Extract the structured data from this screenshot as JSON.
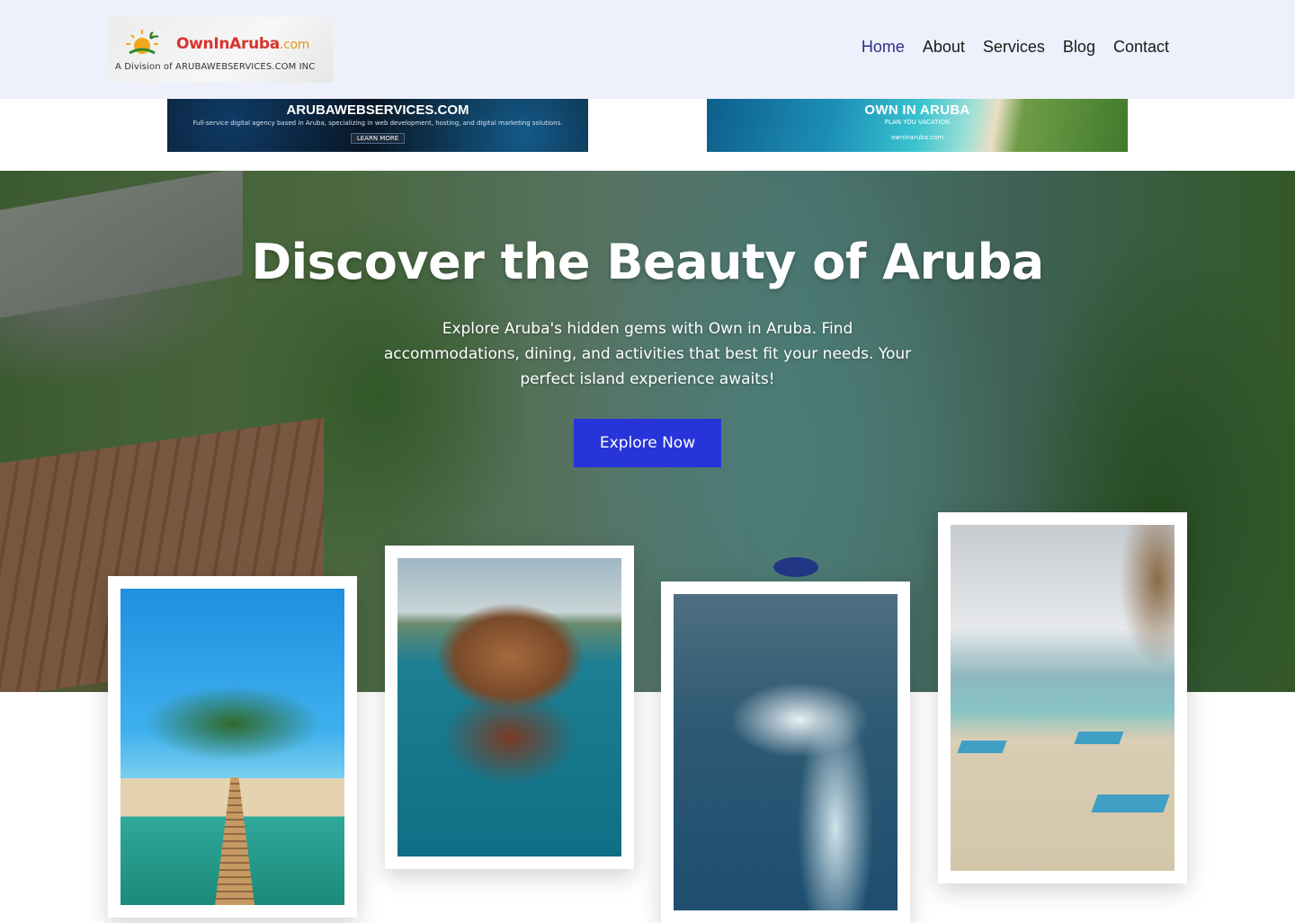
{
  "header": {
    "logo": {
      "brand_main": "OwnInAruba",
      "brand_domain": ".com",
      "subtitle": "A Division of ARUBAWEBSERVICES.COM INC"
    },
    "nav": [
      {
        "label": "Home",
        "active": true
      },
      {
        "label": "About",
        "active": false
      },
      {
        "label": "Services",
        "active": false
      },
      {
        "label": "Blog",
        "active": false
      },
      {
        "label": "Contact",
        "active": false
      }
    ]
  },
  "banners": {
    "left": {
      "title": "ARUBAWEBSERVICES.COM",
      "subtitle": "Full-service digital agency based in Aruba, specializing in web development, hosting, and digital marketing solutions.",
      "button": "LEARN MORE"
    },
    "right": {
      "title": "OWN IN ARUBA",
      "subtitle": "PLAN YOU VACATION",
      "url": "owninaruba.com"
    }
  },
  "hero": {
    "title": "Discover the Beauty of Aruba",
    "text": "Explore Aruba's hidden gems with Own in Aruba. Find accommodations, dining, and activities that best fit your needs. Your perfect island experience awaits!",
    "button": "Explore Now",
    "button_color": "#2734d9"
  },
  "colors": {
    "header_bg": "#eef0fb",
    "nav_active": "#2b2f8a",
    "logo_red": "#d8342b",
    "logo_orange": "#e8961d"
  }
}
